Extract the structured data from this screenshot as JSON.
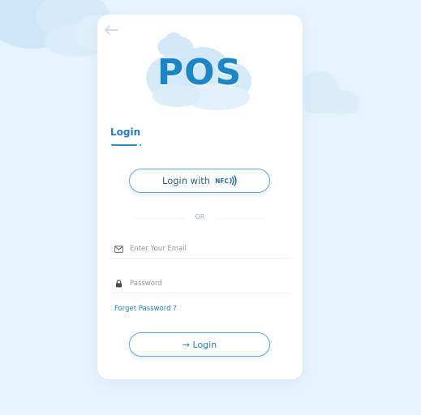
{
  "logo": {
    "text": "POS"
  },
  "heading": {
    "login_label": "Login"
  },
  "nfc_button": {
    "label": "Login with",
    "badge": "NFC"
  },
  "divider": {
    "or_label": "OR"
  },
  "email": {
    "placeholder": "Enter Your Email",
    "icon": "envelope-icon"
  },
  "password": {
    "placeholder": "Password",
    "icon": "lock-icon"
  },
  "forgot_password": {
    "label": "Forget Password ?"
  },
  "login_button": {
    "label": "→ Login"
  },
  "colors": {
    "accent": "#1f7fc0",
    "background": "#e7f3fc",
    "card": "#ffffff"
  }
}
